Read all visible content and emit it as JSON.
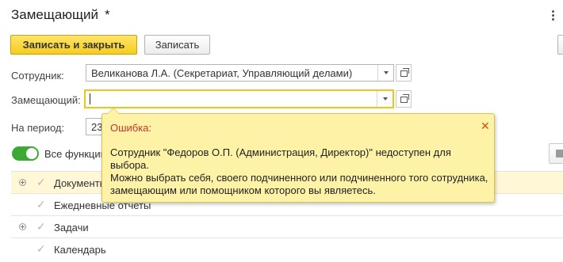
{
  "window": {
    "title": "Замещающий",
    "modified_mark": "*"
  },
  "toolbar": {
    "save_close_label": "Записать и закрыть",
    "save_label": "Записать"
  },
  "form": {
    "employee": {
      "label": "Сотрудник:",
      "value": "Великанова Л.А. (Секретариат, Управляющий делами)"
    },
    "substitute": {
      "label": "Замещающий:",
      "value": ""
    },
    "period": {
      "label": "На период:",
      "value": "23"
    }
  },
  "toggle": {
    "label": "Все функции",
    "on": true
  },
  "functions": [
    {
      "label": "Документы",
      "expandable": true
    },
    {
      "label": "Ежедневные отчеты",
      "expandable": false
    },
    {
      "label": "Задачи",
      "expandable": true
    },
    {
      "label": "Календарь",
      "expandable": false
    }
  ],
  "error_tooltip": {
    "title": "Ошибка:",
    "message": "Сотрудник \"Федоров О.П. (Администрация, Директор)\" недоступен для выбора.\nМожно выбрать себя, своего подчиненного или подчиненного того сотрудника, замещающим или помощником которого вы являетесь."
  },
  "icons": {
    "more": "kebab-menu-icon",
    "dropdown": "chevron-down-icon",
    "open": "open-form-icon",
    "close": "close-icon",
    "expand": "expand-plus-icon",
    "check": "check-icon"
  },
  "colors": {
    "primary_button": "#f6cd1d",
    "focus_border": "#f0c51a",
    "toggle_on": "#3aaa35",
    "tooltip_bg": "#fdf2a6",
    "error_title": "#c0392b",
    "selected_row": "#fff7d6"
  }
}
